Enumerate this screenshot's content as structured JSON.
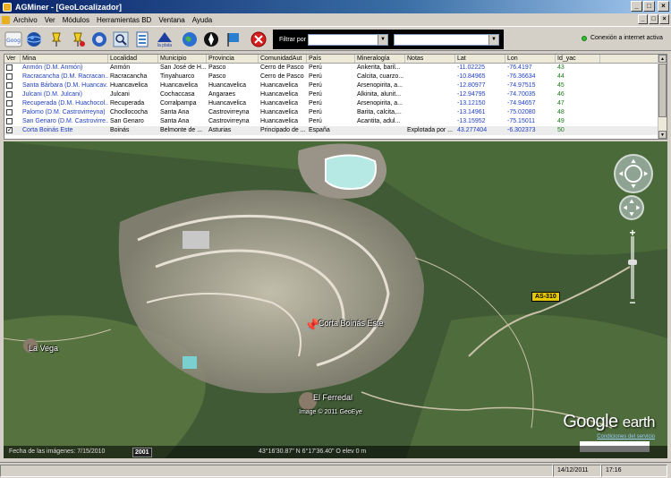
{
  "window": {
    "title": "AGMiner - [GeoLocalizador]",
    "buttons": {
      "minimize": "_",
      "maximize": "□",
      "close": "×"
    }
  },
  "menu": {
    "items": [
      "Archivo",
      "Ver",
      "Módulos",
      "Herramientas BD",
      "Ventana",
      "Ayuda"
    ]
  },
  "toolbar": {
    "filter_label": "Filtrar por",
    "filter_field_value": "",
    "filter_value": "",
    "connection_status": "Conexión a internet activa",
    "connection_color": "#2ec02e",
    "icons": [
      "google-icon",
      "globe-icon",
      "pushpin-icon",
      "pushpin-red-icon",
      "globe-search-icon",
      "magnifier-icon",
      "document-icon",
      "la-plata-icon",
      "world-icon",
      "compass-icon",
      "flag-icon",
      "stop-icon"
    ],
    "tb7_label": "la plata"
  },
  "table": {
    "headers": [
      "Ver",
      "Mina",
      "Localidad",
      "Municipio",
      "Provincia",
      "ComunidadAut",
      "País",
      "Mineralogía",
      "Notas",
      "Lat",
      "Lon",
      "Id_yac"
    ],
    "rows": [
      {
        "checked": false,
        "mina": "Anmón (D.M. Anmón)",
        "localidad": "Anmón",
        "municipio": "San José de H...",
        "provincia": "Pasco",
        "comunidad": "Cerro de Pasco",
        "pais": "Perú",
        "mineralogia": "Ankerita, baril...",
        "notas": "",
        "lat": "-11.02225",
        "lon": "-76.4197",
        "id": "43"
      },
      {
        "checked": false,
        "mina": "Racracancha (D.M. Racracan...",
        "localidad": "Racracancha",
        "municipio": "Tinyahuarco",
        "provincia": "Pasco",
        "comunidad": "Cerro de Pasco",
        "pais": "Perú",
        "mineralogia": "Calcita, cuarzo...",
        "notas": "",
        "lat": "-10.84965",
        "lon": "-76.36634",
        "id": "44"
      },
      {
        "checked": false,
        "mina": "Santa Bárbara (D.M. Huancav...",
        "localidad": "Huancavelica",
        "municipio": "Huancavelica",
        "provincia": "Huancavelica",
        "comunidad": "Huancavelica",
        "pais": "Perú",
        "mineralogia": "Arsenopirita, a...",
        "notas": "",
        "lat": "-12.80977",
        "lon": "-74.97515",
        "id": "45"
      },
      {
        "checked": false,
        "mina": "Julcani (D.M. Julcani)",
        "localidad": "Julcani",
        "municipio": "Cochaccasa",
        "provincia": "Angaraes",
        "comunidad": "Huancavelica",
        "pais": "Perú",
        "mineralogia": "Alkinita, alunit...",
        "notas": "",
        "lat": "-12.94795",
        "lon": "-74.70035",
        "id": "46"
      },
      {
        "checked": false,
        "mina": "Recuperada (D.M. Huachocol...",
        "localidad": "Recuperada",
        "municipio": "Corralpampa",
        "provincia": "Huancavelica",
        "comunidad": "Huancavelica",
        "pais": "Perú",
        "mineralogia": "Arsenopirita, a...",
        "notas": "",
        "lat": "-13.12150",
        "lon": "-74.94657",
        "id": "47"
      },
      {
        "checked": false,
        "mina": "Palomo (D.M. Castrovirreyna)",
        "localidad": "Chocllococha",
        "municipio": "Santa Ana",
        "provincia": "Castrovirreyna",
        "comunidad": "Huancavelica",
        "pais": "Perú",
        "mineralogia": "Barita, calcita,...",
        "notas": "",
        "lat": "-13.14961",
        "lon": "-75.02080",
        "id": "48"
      },
      {
        "checked": false,
        "mina": "San Genaro (D.M. Castrovirre...",
        "localidad": "San Genaro",
        "municipio": "Santa Ana",
        "provincia": "Castrovirreyna",
        "comunidad": "Huancavelica",
        "pais": "Perú",
        "mineralogia": "Acantita, adul...",
        "notas": "",
        "lat": "-13.15952",
        "lon": "-75.15011",
        "id": "49"
      },
      {
        "checked": true,
        "mina": "Corta Boinás Este",
        "localidad": "Boinás",
        "municipio": "Belmonte de ...",
        "provincia": "Asturias",
        "comunidad": "Principado de ...",
        "pais": "España",
        "mineralogia": "",
        "notas": "Explotada por ...",
        "lat": "43.277404",
        "lon": "-6.302373",
        "id": "50"
      }
    ]
  },
  "map": {
    "labels": {
      "mine": "Corta Boinás Este",
      "village1": "La Vega",
      "village2": "El Ferredal",
      "imagery": "Image © 2011 GeoEye",
      "road": "AS-310"
    },
    "branding": {
      "google": "Google",
      "earth": "earth",
      "terms": "Condiciones del servicio"
    },
    "status": {
      "fecha": "Fecha de las imágenes: 7/15/2010",
      "year": "2001",
      "coords": "43°16'30.87\" N   6°17'36.40\" O   elev   0 m"
    }
  },
  "statusbar": {
    "date": "14/12/2011",
    "time": "17:16"
  }
}
